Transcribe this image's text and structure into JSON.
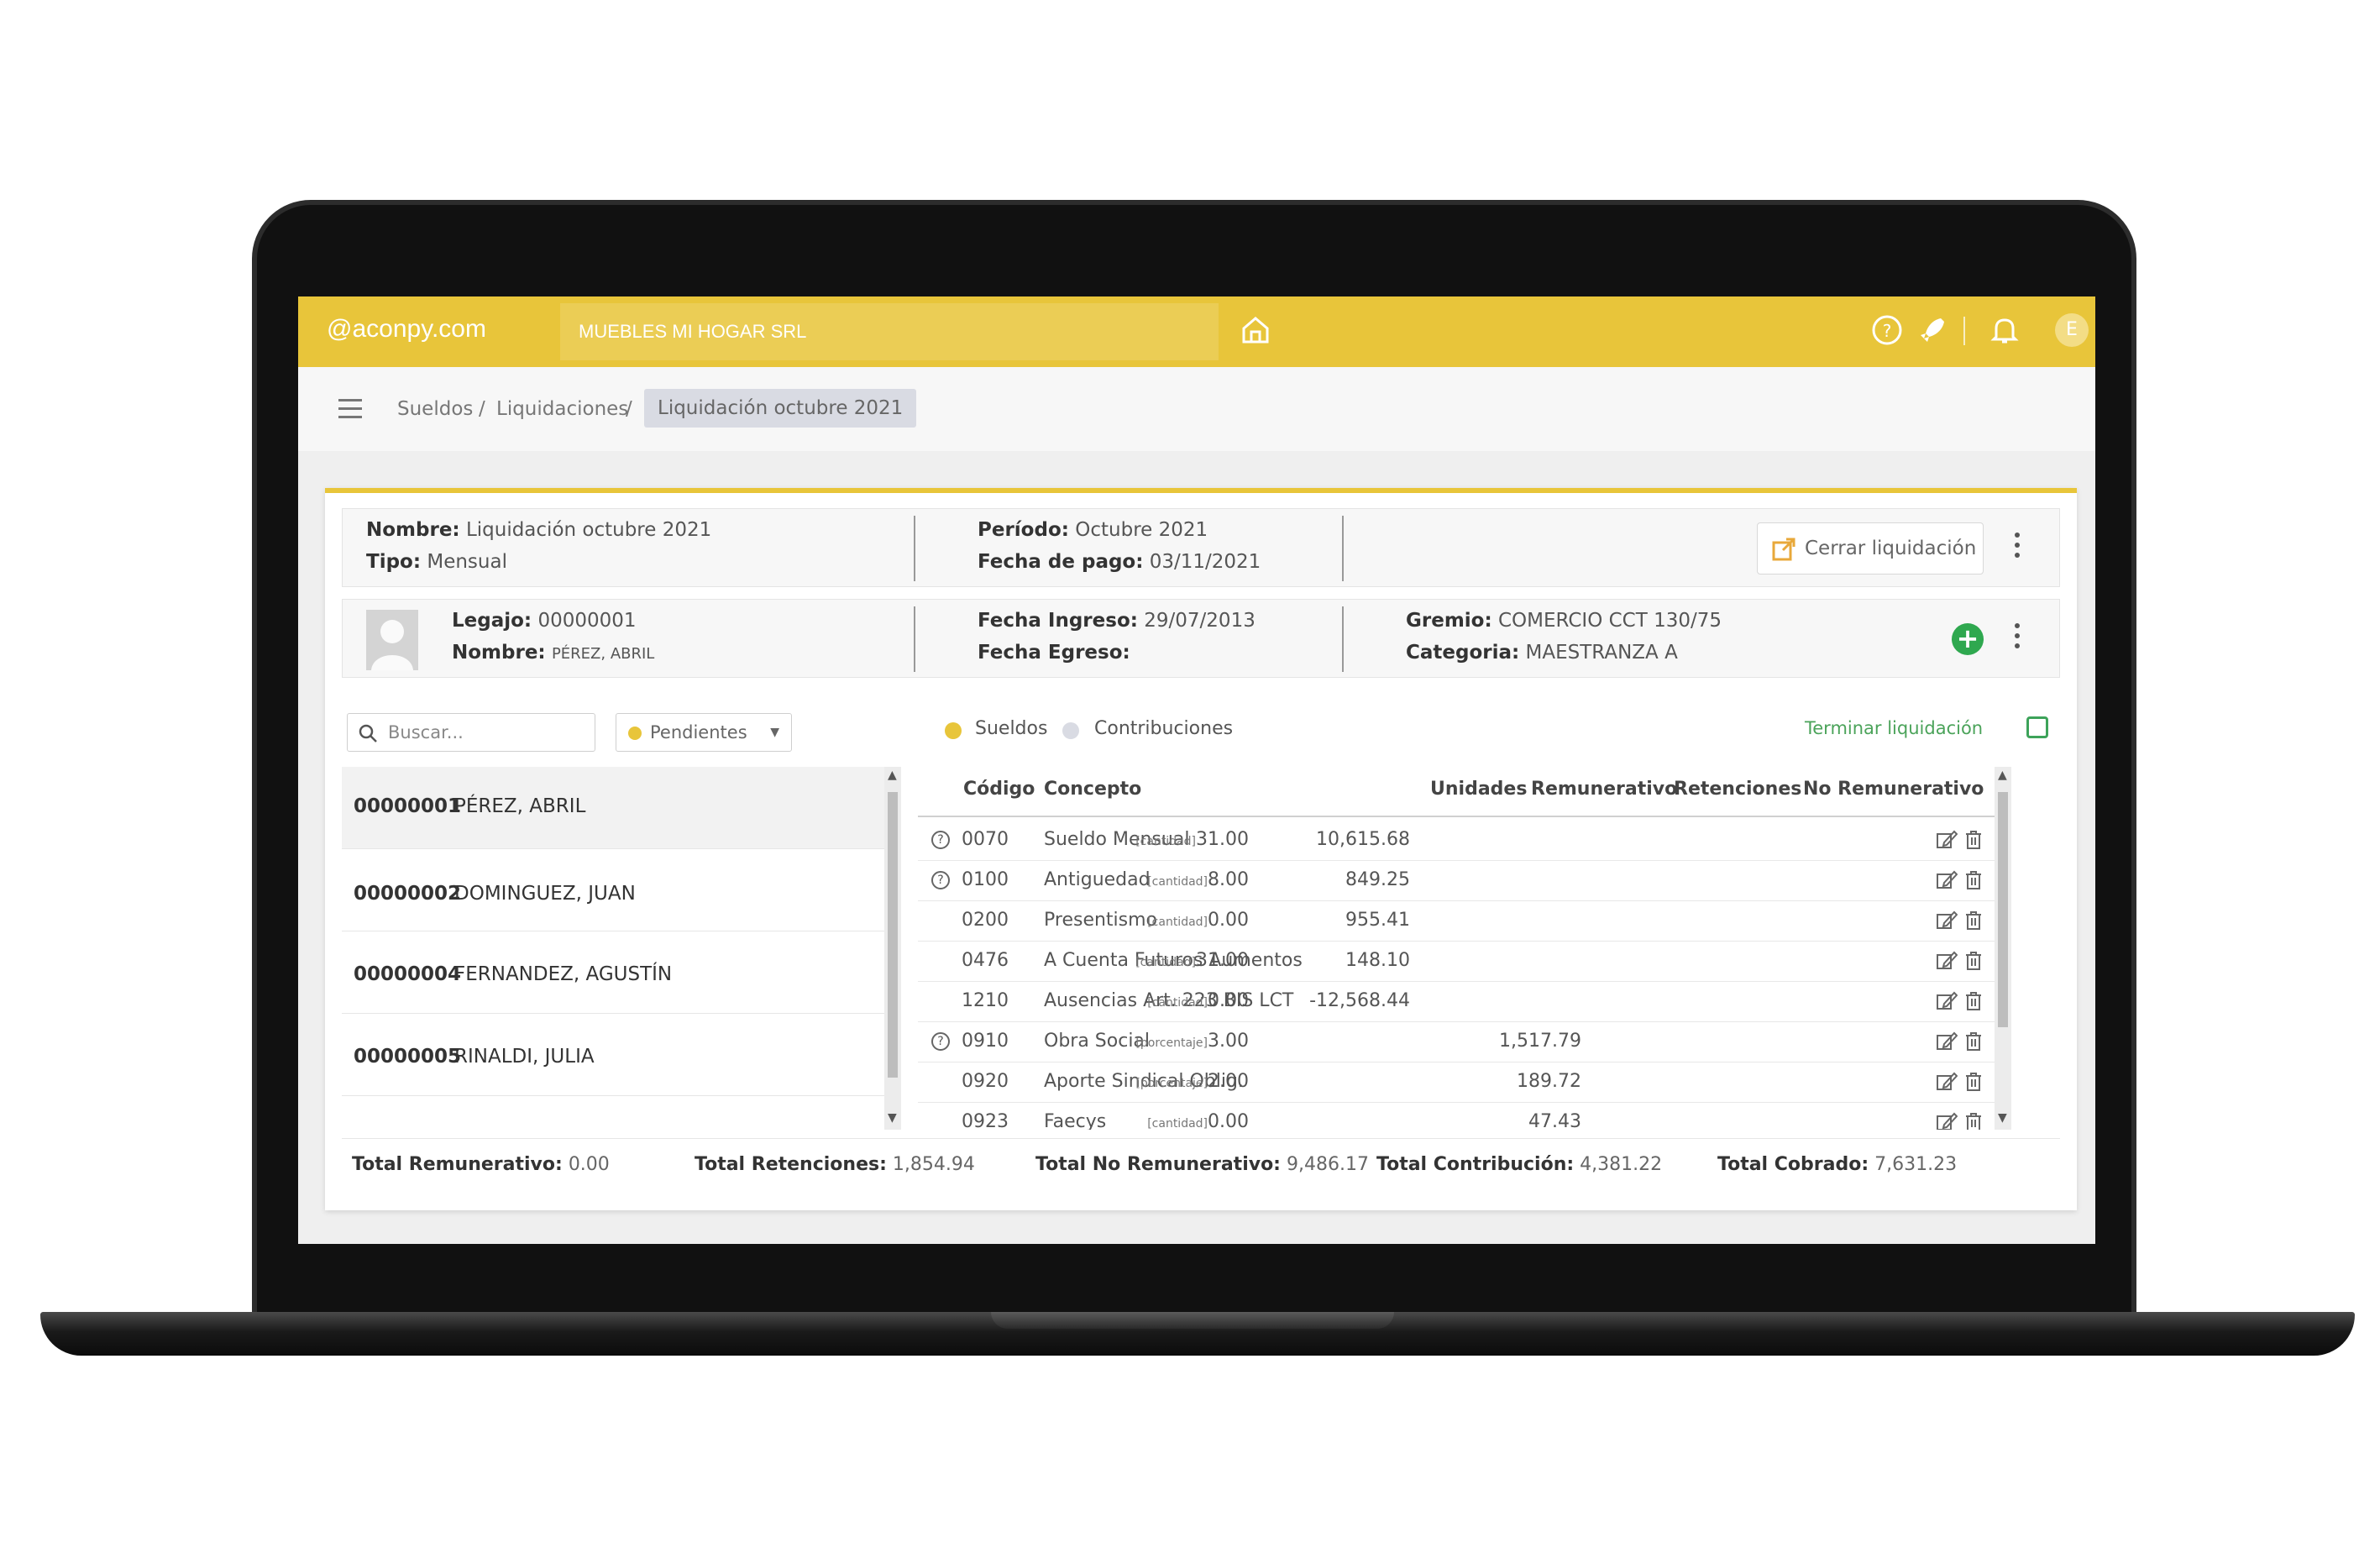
{
  "topbar": {
    "logo": "@aconpy.com",
    "company": "MUEBLES MI HOGAR SRL",
    "avatar_initial": "E"
  },
  "breadcrumb": {
    "items": [
      "Sueldos",
      "Liquidaciones"
    ],
    "separator": "/",
    "active": "Liquidación octubre 2021"
  },
  "liquidacion": {
    "nombre_label": "Nombre:",
    "nombre": "Liquidación octubre 2021",
    "tipo_label": "Tipo:",
    "tipo": "Mensual",
    "periodo_label": "Período:",
    "periodo": "Octubre 2021",
    "fecha_pago_label": "Fecha de pago:",
    "fecha_pago": "03/11/2021",
    "cerrar_label": "Cerrar liquidación"
  },
  "empleado": {
    "legajo_label": "Legajo:",
    "legajo": "00000001",
    "nombre_label": "Nombre:",
    "nombre": "PÉREZ, ABRIL",
    "ingreso_label": "Fecha Ingreso:",
    "ingreso": "29/07/2013",
    "egreso_label": "Fecha Egreso:",
    "egreso": "",
    "gremio_label": "Gremio:",
    "gremio": "COMERCIO CCT 130/75",
    "categoria_label": "Categoria:",
    "categoria": "MAESTRANZA A"
  },
  "filters": {
    "search_placeholder": "Buscar...",
    "status": "Pendientes",
    "legend": [
      "Sueldos",
      "Contribuciones"
    ],
    "terminar_label": "Terminar liquidación"
  },
  "employees": [
    {
      "code": "00000001",
      "name": "PÉREZ, ABRIL"
    },
    {
      "code": "00000002",
      "name": "DOMINGUEZ, JUAN"
    },
    {
      "code": "00000004",
      "name": "FERNANDEZ, AGUSTÍN"
    },
    {
      "code": "00000005",
      "name": "RINALDI, JULIA"
    }
  ],
  "table": {
    "headers": [
      "Código",
      "Concepto",
      "Unidades",
      "Remunerativo",
      "Retenciones",
      "No Remunerativo"
    ],
    "rows": [
      {
        "codigo": "0070",
        "concepto": "Sueldo Mensual",
        "unit_tag": "[cantidad]",
        "unidades": "31.00",
        "remunerativo": "10,615.68",
        "retenciones": "",
        "no_remunerativo": ""
      },
      {
        "codigo": "0100",
        "concepto": "Antiguedad",
        "unit_tag": "[cantidad]",
        "unidades": "8.00",
        "remunerativo": "849.25",
        "retenciones": "",
        "no_remunerativo": ""
      },
      {
        "codigo": "0200",
        "concepto": "Presentismo",
        "unit_tag": "[cantidad]",
        "unidades": "0.00",
        "remunerativo": "955.41",
        "retenciones": "",
        "no_remunerativo": ""
      },
      {
        "codigo": "0476",
        "concepto": "A Cuenta Futuros Aumentos",
        "unit_tag": "[cantidad]",
        "unidades": "31.00",
        "remunerativo": "148.10",
        "retenciones": "",
        "no_remunerativo": ""
      },
      {
        "codigo": "1210",
        "concepto": "Ausencias Art. 223 BIS LCT",
        "unit_tag": "[cantidad]",
        "unidades": "0.00",
        "remunerativo": "-12,568.44",
        "retenciones": "",
        "no_remunerativo": ""
      },
      {
        "codigo": "0910",
        "concepto": "Obra Social",
        "unit_tag": "[porcentaje]",
        "unidades": "3.00",
        "remunerativo": "",
        "retenciones": "1,517.79",
        "no_remunerativo": ""
      },
      {
        "codigo": "0920",
        "concepto": "Aporte Sindical Oblig.",
        "unit_tag": "[porcentaje]",
        "unidades": "2.00",
        "remunerativo": "",
        "retenciones": "189.72",
        "no_remunerativo": ""
      },
      {
        "codigo": "0923",
        "concepto": "Faecys",
        "unit_tag": "[cantidad]",
        "unidades": "0.00",
        "remunerativo": "",
        "retenciones": "47.43",
        "no_remunerativo": ""
      }
    ]
  },
  "totals": [
    {
      "label": "Total Remunerativo:",
      "value": "0.00"
    },
    {
      "label": "Total Retenciones:",
      "value": "1,854.94"
    },
    {
      "label": "Total No Remunerativo:",
      "value": "9,486.17"
    },
    {
      "label": "Total Contribución:",
      "value": "4,381.22"
    },
    {
      "label": "Total Cobrado:",
      "value": "7,631.23"
    }
  ],
  "colors": {
    "brand_yellow": "#e8c53a",
    "sueldos_dot": "#e8c53a",
    "contribuciones_dot": "#d9dbe3",
    "add_green": "#2fa84f",
    "terminar_green": "#4ba35a"
  }
}
